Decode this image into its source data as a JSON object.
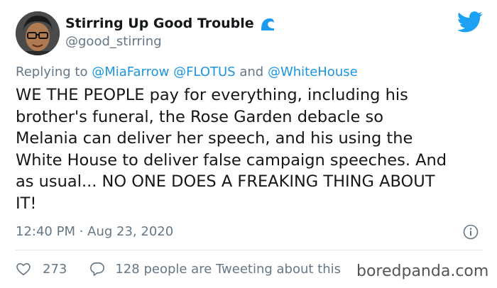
{
  "author": {
    "name": "Stirring Up Good Trouble",
    "handle": "@good_stirring",
    "avatar_icon": "avatar",
    "badge_icon": "wave-icon"
  },
  "header": {
    "platform_icon": "twitter-bird-icon",
    "brand_color": "#1da1f2"
  },
  "reply": {
    "prefix": "Replying to",
    "mention1": "@MiaFarrow",
    "mention2": "@FLOTUS",
    "conjunction": "and",
    "mention3": "@WhiteHouse",
    "mention_color": "#1b95e0"
  },
  "tweet": {
    "text": "WE THE PEOPLE pay for everything, including his\nbrother's funeral, the Rose Garden debacle so\nMelania can deliver her speech, and his using the\nWhite House to deliver false campaign speeches. And\nas usual... NO ONE DOES A FREAKING THING ABOUT\nIT!"
  },
  "meta": {
    "timestamp": "12:40 PM · Aug 23, 2020",
    "info_icon": "info-icon"
  },
  "actions": {
    "likes": "273",
    "replies_text": "128 people are Tweeting about this"
  },
  "watermark": "boredpanda.com"
}
